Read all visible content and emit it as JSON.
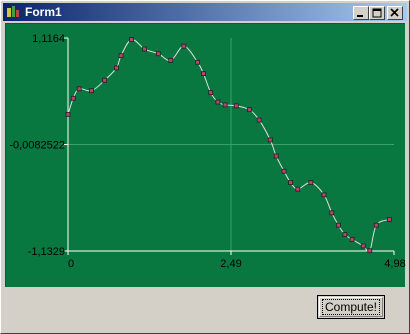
{
  "window": {
    "title": "Form1"
  },
  "titlebar_buttons": {
    "minimize": "minimize-icon",
    "maximize": "maximize-icon",
    "close": "close-icon"
  },
  "colors": {
    "plot_bg": "#087840",
    "curve": "#e0e0e0",
    "marker_fill": "#c04070",
    "axis": "#ffffff",
    "grid": "#3aa070"
  },
  "button": {
    "label": "Compute!"
  },
  "chart_data": {
    "type": "line",
    "title": "",
    "xlabel": "",
    "ylabel": "",
    "xlim": [
      0,
      4.98
    ],
    "ylim": [
      -1.1329,
      1.1164
    ],
    "x_ticks": [
      "0",
      "2,49",
      "4,98"
    ],
    "y_ticks": [
      "1,1164",
      "-0,0082522",
      "-1,1329"
    ],
    "grid": true,
    "series": [
      {
        "x": [
          0,
          0.08,
          0.17,
          0.36,
          0.56,
          0.74,
          0.81,
          0.97,
          1.17,
          1.38,
          1.57,
          1.77,
          1.98,
          2.07,
          2.18,
          2.29,
          2.4,
          2.57,
          2.77,
          2.92,
          3.09,
          3.18,
          3.3,
          3.4,
          3.51,
          3.71,
          3.91,
          4.03,
          4.13,
          4.23,
          4.34,
          4.51,
          4.61,
          4.71,
          4.91
        ],
        "y": [
          0.31,
          0.48,
          0.58,
          0.56,
          0.67,
          0.8,
          0.93,
          1.1,
          1.0,
          0.95,
          0.88,
          1.03,
          0.86,
          0.74,
          0.54,
          0.44,
          0.41,
          0.4,
          0.36,
          0.25,
          0.04,
          -0.13,
          -0.29,
          -0.41,
          -0.48,
          -0.41,
          -0.54,
          -0.73,
          -0.86,
          -0.96,
          -1.01,
          -1.08,
          -1.13,
          -0.86,
          -0.8
        ]
      }
    ]
  }
}
